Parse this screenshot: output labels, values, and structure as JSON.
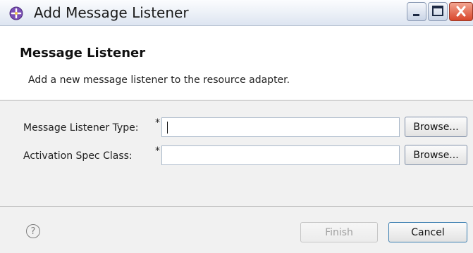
{
  "window": {
    "title": "Add Message Listener",
    "icons": {
      "app": "eclipse-plugin-icon",
      "minimize": "minimize-icon",
      "maximize": "maximize-icon",
      "close": "close-icon"
    },
    "colors": {
      "titlebar": "#dde5f1",
      "close": "#d8462b"
    }
  },
  "header": {
    "title": "Message Listener",
    "description": "Add a new message listener to the resource adapter."
  },
  "form": {
    "fields": [
      {
        "label": "Message Listener Type:",
        "required": "*",
        "value": "",
        "browse_label": "Browse..."
      },
      {
        "label": "Activation Spec Class:",
        "required": "*",
        "value": "",
        "browse_label": "Browse..."
      }
    ]
  },
  "footer": {
    "help_icon": "help-icon",
    "help_glyph": "?",
    "finish_label": "Finish",
    "cancel_label": "Cancel"
  }
}
